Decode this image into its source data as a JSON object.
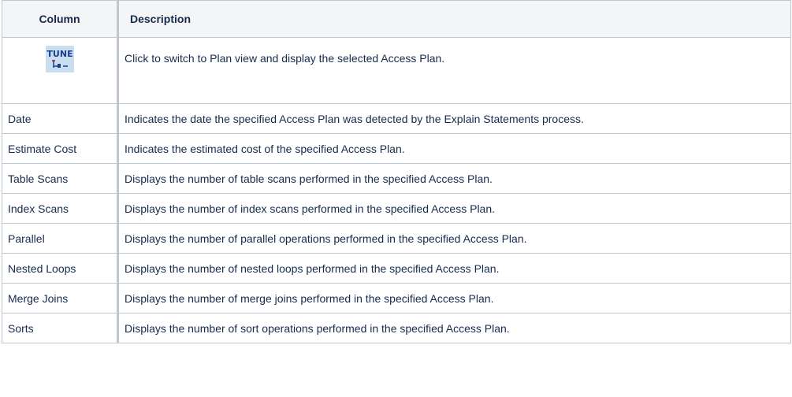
{
  "table": {
    "headers": [
      "Column",
      "Description"
    ],
    "tune_row": {
      "icon": "tune-icon",
      "icon_text": "TUNE",
      "description": "Click to switch to Plan view and display the selected Access Plan."
    },
    "rows": [
      {
        "column": "Date",
        "description": "Indicates the date the specified Access Plan was detected by the Explain Statements process."
      },
      {
        "column": "Estimate Cost",
        "description": "Indicates the estimated cost of the specified Access Plan."
      },
      {
        "column": "Table Scans",
        "description": "Displays the number of table scans performed in the specified Access Plan."
      },
      {
        "column": "Index Scans",
        "description": "Displays the number of index scans performed in the specified Access Plan."
      },
      {
        "column": "Parallel",
        "description": "Displays the number of parallel operations performed in the specified Access Plan."
      },
      {
        "column": "Nested Loops",
        "description": "Displays the number of nested loops performed in the specified Access Plan."
      },
      {
        "column": "Merge Joins",
        "description": "Displays the number of merge joins performed in the specified Access Plan."
      },
      {
        "column": "Sorts",
        "description": "Displays the number of sort operations performed in the specified Access Plan."
      }
    ]
  },
  "colors": {
    "border": "#c1c7d0",
    "header_bg": "#f4f5f7",
    "icon_bg": "#c9dff0",
    "icon_text": "#1a3d8f",
    "icon_accent": "#d2333a"
  }
}
